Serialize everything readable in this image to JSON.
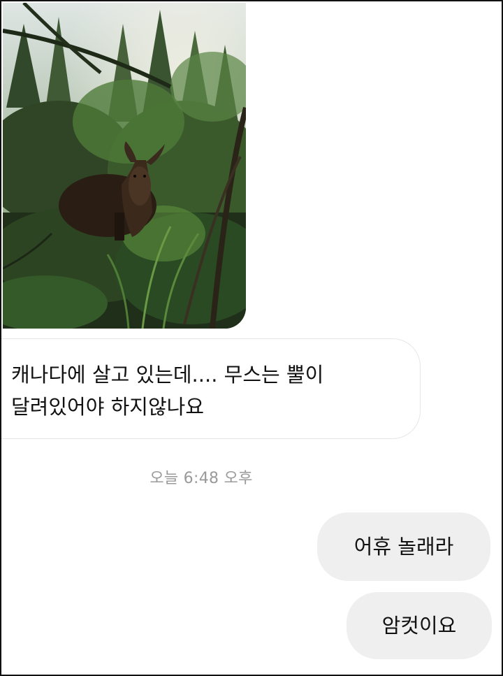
{
  "conversation": {
    "incoming_photo": {
      "subject": "moose-in-forest-photo"
    },
    "incoming_message": {
      "line1": "캐나다에 살고 있는데.... 무스는 뿔이",
      "line2": "달려있어야 하지않나요"
    },
    "timestamp": "오늘 6:48 오후",
    "outgoing_messages": [
      {
        "text": "어휴 놀래라"
      },
      {
        "text": "암컷이요"
      }
    ]
  },
  "colors": {
    "outgoing_bubble": "#efefef",
    "incoming_bubble_border": "#e6e6e6",
    "timestamp_text": "#9a9a9a"
  }
}
